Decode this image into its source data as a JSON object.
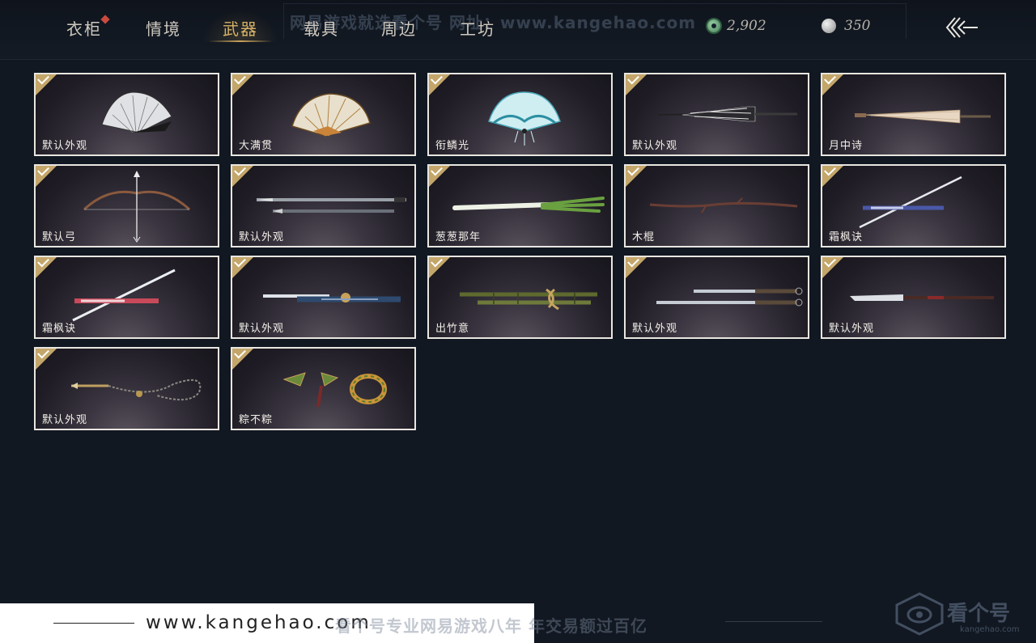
{
  "tabs": [
    {
      "label": "衣柜",
      "active": false,
      "has_notification": true
    },
    {
      "label": "情境",
      "active": false
    },
    {
      "label": "武器",
      "active": true
    },
    {
      "label": "载具",
      "active": false
    },
    {
      "label": "周边",
      "active": false
    },
    {
      "label": "工坊",
      "active": false
    }
  ],
  "watermark_top": "网易游戏就选看个号  网址：www.kangehao.com",
  "currency": {
    "jade_amount": "2,902",
    "silver_amount": "350"
  },
  "icons": {
    "back": "back-arrow-icon",
    "jade": "jade-coin-icon",
    "silver": "silver-coin-icon",
    "owned": "checkmark-icon"
  },
  "colors": {
    "active_tab": "#d8b266",
    "card_border": "#e8e6e0",
    "owned_badge": "#c4a66a",
    "notification": "#c94b3e"
  },
  "items": [
    {
      "name": "默认外观",
      "type": "fan-white",
      "owned": true
    },
    {
      "name": "大满贯",
      "type": "fan-gold",
      "owned": true
    },
    {
      "name": "衔鳞光",
      "type": "fan-cyan",
      "owned": true
    },
    {
      "name": "默认外观",
      "type": "umbrella-dark",
      "owned": true
    },
    {
      "name": "月中诗",
      "type": "umbrella-light",
      "owned": true
    },
    {
      "name": "默认弓",
      "type": "bow",
      "owned": true
    },
    {
      "name": "默认外观",
      "type": "twin-spear",
      "owned": true
    },
    {
      "name": "葱葱那年",
      "type": "scallion",
      "owned": true
    },
    {
      "name": "木棍",
      "type": "stick",
      "owned": true
    },
    {
      "name": "霜枫诀",
      "type": "sword-blue",
      "owned": true
    },
    {
      "name": "霜枫诀",
      "type": "sword-red",
      "owned": true
    },
    {
      "name": "默认外观",
      "type": "ornate-sword",
      "owned": true
    },
    {
      "name": "出竹意",
      "type": "bamboo",
      "owned": true
    },
    {
      "name": "默认外观",
      "type": "twin-blade",
      "owned": true
    },
    {
      "name": "默认外观",
      "type": "glaive",
      "owned": true
    },
    {
      "name": "默认外观",
      "type": "rope-dart",
      "owned": true
    },
    {
      "name": "粽不粽",
      "type": "zongzi-dart",
      "owned": true
    }
  ],
  "footer": {
    "url": "www.kangehao.com",
    "slogan": "看个号专业网易游戏八年   年交易额过百亿",
    "logo_text": "看个号",
    "logo_sub": "kangehao.com"
  }
}
